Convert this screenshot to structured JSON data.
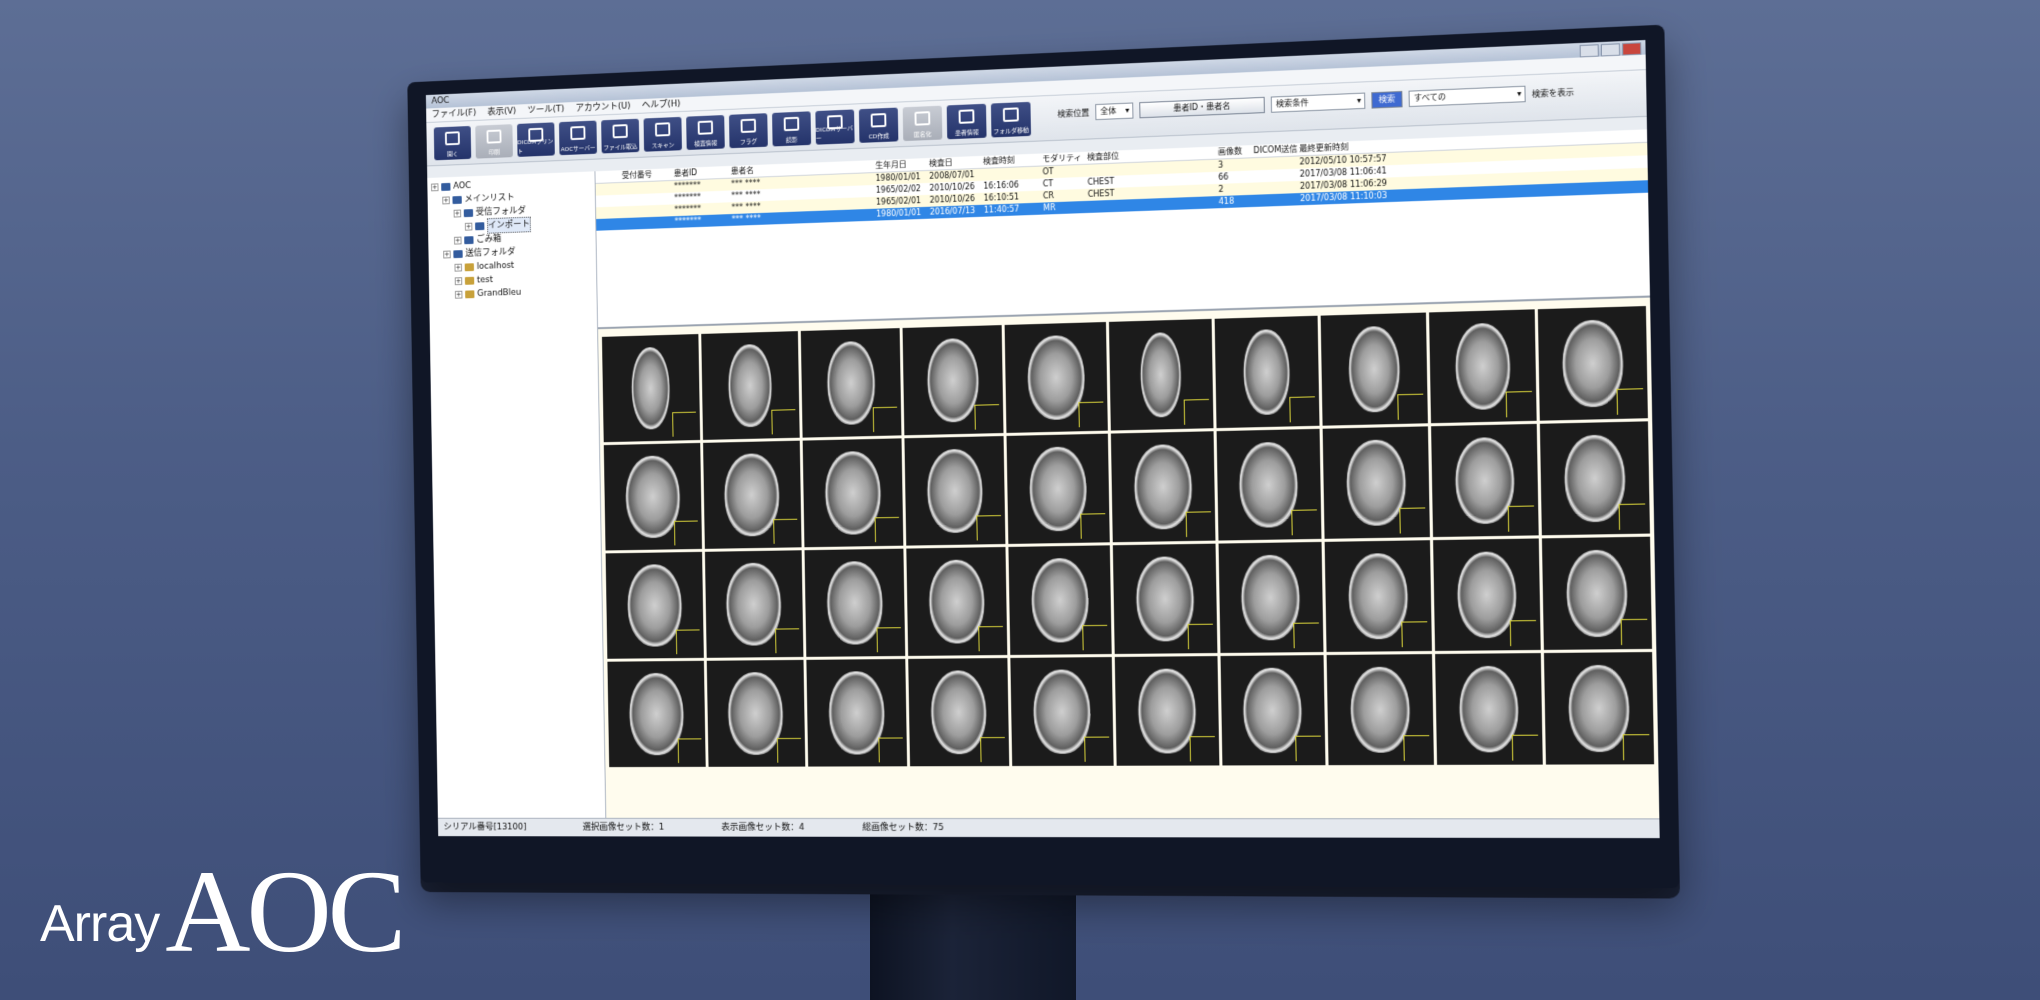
{
  "brand": {
    "prefix": "Array",
    "name": "AOC"
  },
  "window": {
    "title": "AOC"
  },
  "menu": [
    "ファイル(F)",
    "表示(V)",
    "ツール(T)",
    "アカウント(U)",
    "ヘルプ(H)"
  ],
  "toolbar": [
    {
      "label": "開く",
      "icon": "open-icon",
      "enabled": true
    },
    {
      "label": "印刷",
      "icon": "print-icon",
      "enabled": false
    },
    {
      "label": "DICOMプリント",
      "icon": "dicom-print-icon",
      "enabled": true
    },
    {
      "label": "AOCサーバー",
      "icon": "server-icon",
      "enabled": true
    },
    {
      "label": "ファイル取込",
      "icon": "import-icon",
      "enabled": true
    },
    {
      "label": "スキャン",
      "icon": "scan-icon",
      "enabled": true
    },
    {
      "label": "検査情報",
      "icon": "info-icon",
      "enabled": true
    },
    {
      "label": "フラグ",
      "icon": "flag-icon",
      "enabled": true
    },
    {
      "label": "読影",
      "icon": "report-icon",
      "enabled": true
    },
    {
      "label": "DICOMサーバー",
      "icon": "dicom-server-icon",
      "enabled": true
    },
    {
      "label": "CD作成",
      "icon": "cd-icon",
      "enabled": true
    },
    {
      "label": "匿名化",
      "icon": "anonymize-icon",
      "enabled": false
    },
    {
      "label": "患者情報",
      "icon": "patient-icon",
      "enabled": true
    },
    {
      "label": "フォルダ移動",
      "icon": "folder-move-icon",
      "enabled": true
    }
  ],
  "search": {
    "location_label": "検索位置",
    "location_value": "全体",
    "field_button": "患者ID・患者名",
    "condition_label": "検索条件",
    "search_button": "検索",
    "range_value": "すべての",
    "show_all": "検索を表示"
  },
  "tree": [
    {
      "label": "AOC",
      "level": 0,
      "icon": "computer-icon"
    },
    {
      "label": "メインリスト",
      "level": 1,
      "icon": "list-icon"
    },
    {
      "label": "受信フォルダ",
      "level": 2,
      "icon": "inbox-icon"
    },
    {
      "label": "インポート",
      "level": 3,
      "icon": "import-icon",
      "selected": true
    },
    {
      "label": "ごみ箱",
      "level": 2,
      "icon": "trash-icon"
    },
    {
      "label": "送信フォルダ",
      "level": 1,
      "icon": "outbox-icon"
    },
    {
      "label": "localhost",
      "level": 2,
      "icon": "folder-icon"
    },
    {
      "label": "test",
      "level": 2,
      "icon": "folder-icon"
    },
    {
      "label": "GrandBleu",
      "level": 2,
      "icon": "folder-icon"
    }
  ],
  "studies": {
    "columns": [
      "",
      "",
      "受付番号",
      "患者ID",
      "患者名",
      "生年月日",
      "検査日",
      "検査時刻",
      "モダリティ",
      "検査部位",
      "画像数",
      "DICOM送信",
      "最終更新時刻"
    ],
    "rows": [
      [
        "",
        "",
        "",
        "*******",
        "*** ****",
        "1980/01/01",
        "2008/07/01",
        "",
        "OT",
        "",
        "3",
        "",
        "2012/05/10 10:57:57"
      ],
      [
        "",
        "",
        "",
        "*******",
        "*** ****",
        "1965/02/02",
        "2010/10/26",
        "16:16:06",
        "CT",
        "CHEST",
        "66",
        "",
        "2017/03/08 11:06:41"
      ],
      [
        "",
        "",
        "",
        "*******",
        "*** ****",
        "1965/02/01",
        "2010/10/26",
        "16:10:51",
        "CR",
        "CHEST",
        "2",
        "",
        "2017/03/08 11:06:29"
      ],
      [
        "",
        "",
        "",
        "*******",
        "*** ****",
        "1980/01/01",
        "2016/07/13",
        "11:40:57",
        "MR",
        "",
        "418",
        "",
        "2017/03/08 11:10:03"
      ]
    ],
    "selected_row": 3
  },
  "status": {
    "serial": "シリアル番号[13100]",
    "selected": "選択画像セット数：1",
    "shown": "表示画像セット数：4",
    "total": "総画像セット数：75"
  }
}
